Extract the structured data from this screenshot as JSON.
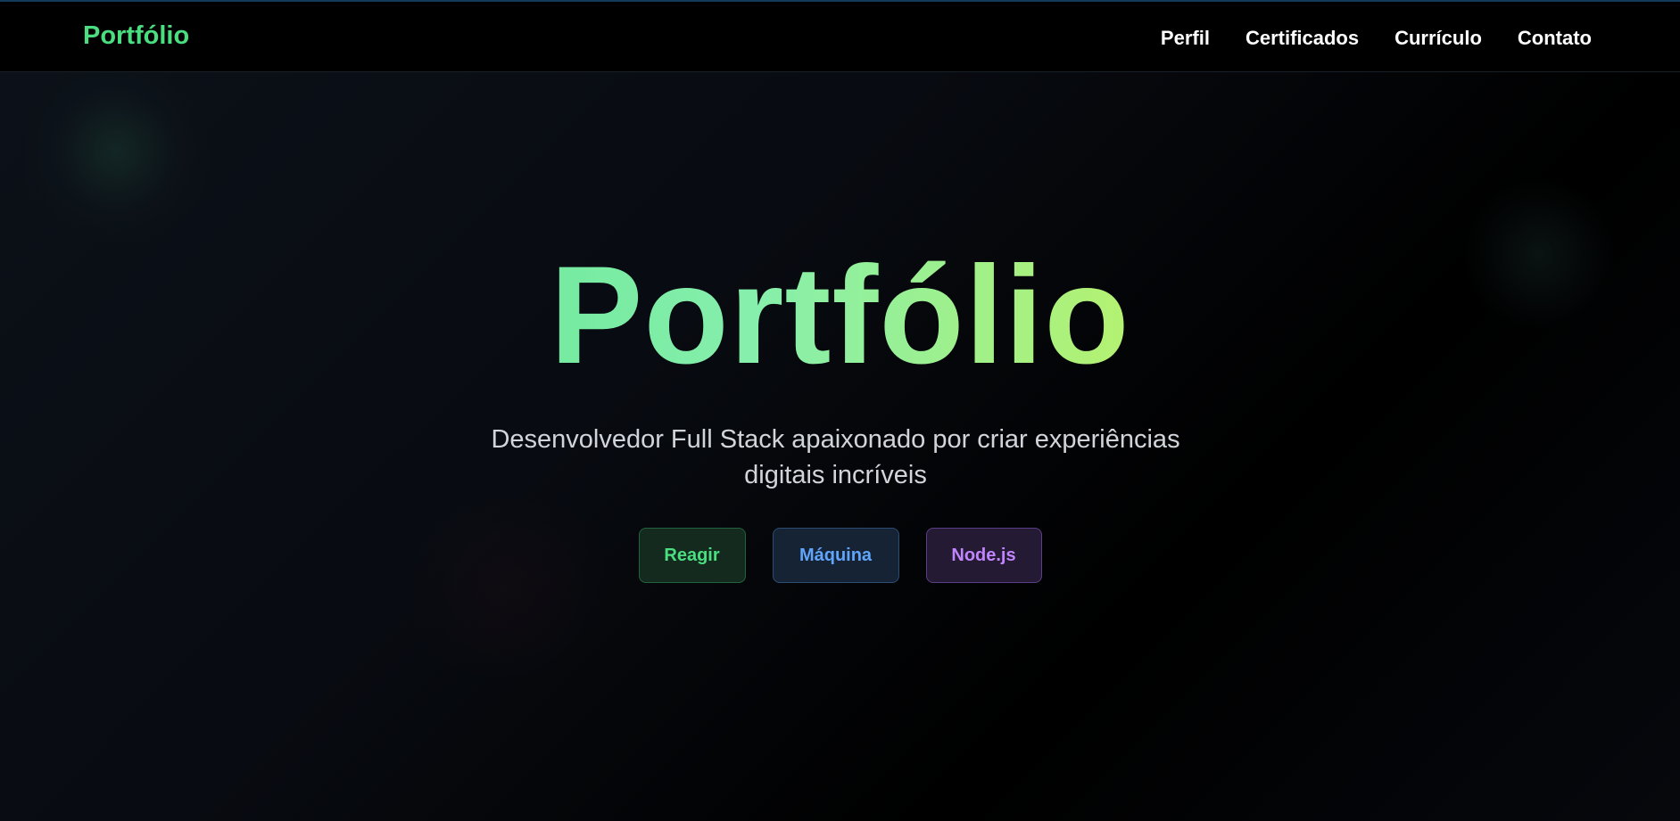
{
  "navbar": {
    "brand": "Portfólio",
    "links": [
      "Perfil",
      "Certificados",
      "Currículo",
      "Contato"
    ]
  },
  "hero": {
    "title": "Portfólio",
    "subtitle": "Desenvolvedor Full Stack apaixonado por criar experiências digitais incríveis",
    "tags": [
      "Reagir",
      "Máquina",
      "Node.js"
    ]
  },
  "colors": {
    "accent_green": "#4ade80",
    "accent_blue": "#60a5fa",
    "accent_purple": "#c084fc",
    "title_gradient_end": "#fde047",
    "background": "#000000"
  }
}
